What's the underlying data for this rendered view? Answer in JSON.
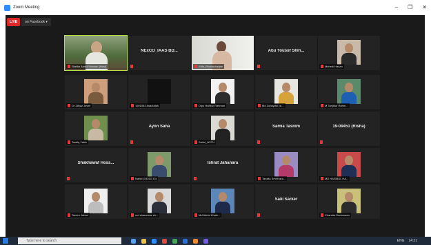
{
  "window": {
    "title": "Zoom Meeting",
    "minimize": "–",
    "restore": "❐",
    "close": "✕"
  },
  "live": {
    "tag": "LIVE",
    "destination": "on Facebook ▾"
  },
  "tiles": [
    {
      "id": "t0",
      "kind": "video",
      "video": "outdoor",
      "label": "Sheikh Abdul Hannan (Host)",
      "active": true
    },
    {
      "id": "t1",
      "kind": "name",
      "center": "NExCO_IAAS BD..."
    },
    {
      "id": "t2",
      "kind": "video",
      "video": "room",
      "label": "Afifa_Bhattacharjee"
    },
    {
      "id": "t3",
      "kind": "name",
      "center": "Abu Yousuf Shih..."
    },
    {
      "id": "t4",
      "kind": "photo",
      "label": "Mehedi Hasan",
      "bg": "#c9b9a8",
      "shirt": "#2a2a2a"
    },
    {
      "id": "t5",
      "kind": "photo",
      "label": "Dr Zilhaz Jewel",
      "bg": "#cf9f7c",
      "shirt": "#7a5b3e"
    },
    {
      "id": "t6",
      "kind": "photo",
      "label": "1901083 Asadullah",
      "bg": "#111111",
      "shirt": "#111111",
      "dark": true
    },
    {
      "id": "t7",
      "kind": "photo",
      "label": "Dipu Hafizur Rahman",
      "bg": "#f2f2f2",
      "shirt": "#2d2d2d"
    },
    {
      "id": "t8",
      "kind": "photo",
      "label": "Md Zobaydul Isl...",
      "bg": "#e8e6e0",
      "shirt": "#d5a23b"
    },
    {
      "id": "t9",
      "kind": "photo",
      "label": "M Tanjidur Rahm...",
      "bg": "#5a8a6a",
      "shirt": "#1d5fb3"
    },
    {
      "id": "t10",
      "kind": "photo",
      "label": "Tawfiq Yahin",
      "bg": "#6f8f4c",
      "shirt": "#c7b9a4"
    },
    {
      "id": "t11",
      "kind": "name",
      "center": "Ayon Saha"
    },
    {
      "id": "t12",
      "kind": "photo",
      "label": "Saiful_NSTU",
      "bg": "#dad9d4",
      "shirt": "#222222"
    },
    {
      "id": "t13",
      "kind": "name",
      "center": "Samia Tasnim"
    },
    {
      "id": "t14",
      "kind": "name",
      "center": "19-09451 (Risha)"
    },
    {
      "id": "t15",
      "kind": "name",
      "center": "Shakhawat Hoss..."
    },
    {
      "id": "t16",
      "kind": "photo",
      "label": "Nahid (14010 10)",
      "bg": "#7f9a6a",
      "shirt": "#3a4c6e"
    },
    {
      "id": "t17",
      "kind": "name",
      "center": "Ishrat Jahanara"
    },
    {
      "id": "t18",
      "kind": "photo",
      "label": "Tanzila Smriti ara...",
      "bg": "#9a8cc2",
      "shirt": "#b43a6a"
    },
    {
      "id": "t19",
      "kind": "photo",
      "label": "MD HASIBUL HA...",
      "bg": "#c94a4a",
      "shirt": "#1e2e55"
    },
    {
      "id": "t20",
      "kind": "photo",
      "label": "Tamim Jahan",
      "bg": "#efefef",
      "shirt": "#bdbdbd"
    },
    {
      "id": "t21",
      "kind": "photo",
      "label": "md shanewaz sh...",
      "bg": "#d9d9d9",
      "shirt": "#2a2f3a"
    },
    {
      "id": "t22",
      "kind": "photo",
      "label": "Md Abdul Khale...",
      "bg": "#5d86b8",
      "shirt": "#1d2a4a"
    },
    {
      "id": "t23",
      "kind": "name",
      "center": "Salil Sarker"
    },
    {
      "id": "t24",
      "kind": "photo",
      "label": "Chandra Darmawan",
      "bg": "#c9c07a",
      "shirt": "#2c2c2c"
    }
  ],
  "taskbar": {
    "search_placeholder": "Type here to search",
    "lang": "ENG",
    "time": "14:21",
    "icon_colors": [
      "#5aa0f0",
      "#f0c040",
      "#2d8cff",
      "#e04a3a",
      "#4aa35a",
      "#2d6fdc",
      "#f08a2a",
      "#7a5ae0"
    ]
  }
}
